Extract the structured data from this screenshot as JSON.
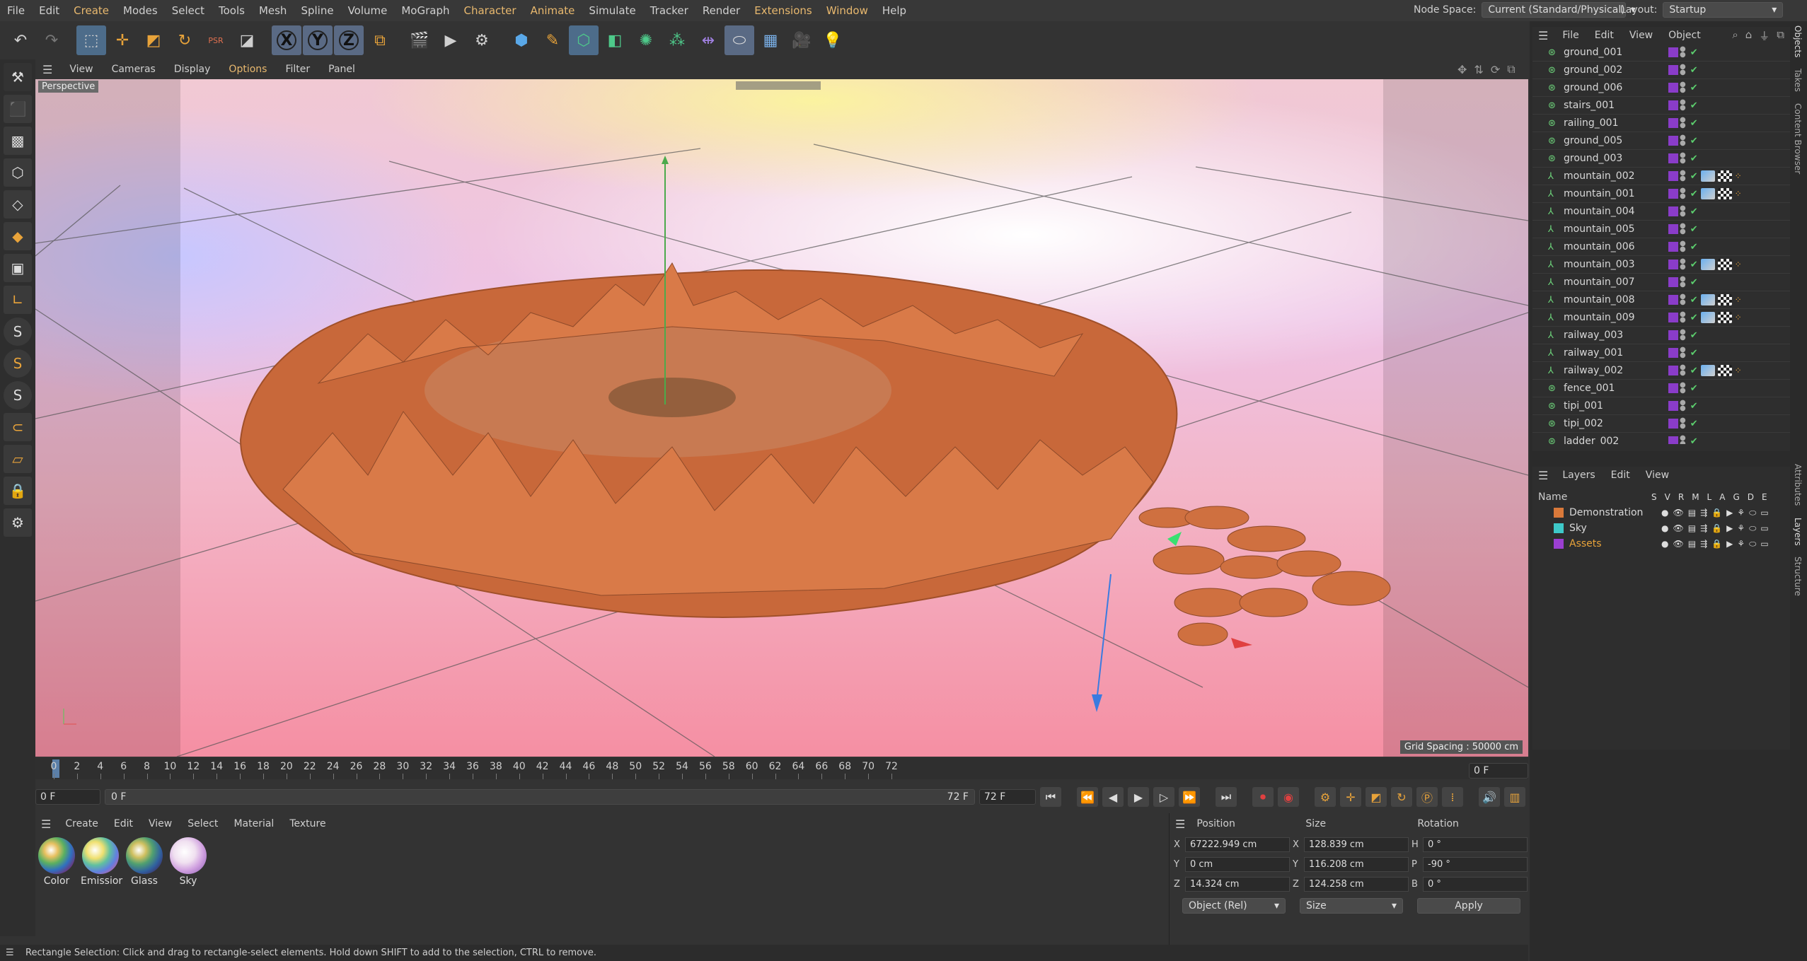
{
  "menubar": {
    "items": [
      "File",
      "Edit",
      "Create",
      "Modes",
      "Select",
      "Tools",
      "Mesh",
      "Spline",
      "Volume",
      "MoGraph",
      "Character",
      "Animate",
      "Simulate",
      "Tracker",
      "Render",
      "Extensions",
      "Window",
      "Help"
    ],
    "node_space_label": "Node Space:",
    "node_space_value": "Current (Standard/Physical)",
    "layout_label": "Layout:",
    "layout_value": "Startup"
  },
  "toolbar": {
    "axis_x": "X",
    "axis_y": "Y",
    "axis_z": "Z",
    "psr": "PSR"
  },
  "viewport": {
    "menu": [
      "View",
      "Cameras",
      "Display",
      "Options",
      "Filter",
      "Panel"
    ],
    "label": "Perspective",
    "grid_spacing": "Grid Spacing : 50000 cm"
  },
  "timeline": {
    "ticks": [
      "0",
      "2",
      "4",
      "6",
      "8",
      "10",
      "12",
      "14",
      "16",
      "18",
      "20",
      "22",
      "24",
      "26",
      "28",
      "30",
      "32",
      "34",
      "36",
      "38",
      "40",
      "42",
      "44",
      "46",
      "48",
      "50",
      "52",
      "54",
      "56",
      "58",
      "60",
      "62",
      "64",
      "66",
      "68",
      "70",
      "72"
    ],
    "current_frame": "0 F",
    "start_frame": "0 F",
    "range_start": "0 F",
    "range_end": "72 F",
    "end_frame": "72 F"
  },
  "materials": {
    "menu": [
      "Create",
      "Edit",
      "View",
      "Select",
      "Material",
      "Texture"
    ],
    "items": [
      {
        "name": "Color"
      },
      {
        "name": "Emissior"
      },
      {
        "name": "Glass"
      },
      {
        "name": "Sky"
      }
    ]
  },
  "coords": {
    "position_header": "Position",
    "size_header": "Size",
    "rotation_header": "Rotation",
    "px": "67222.949 cm",
    "py": "0 cm",
    "pz": "14.324 cm",
    "sx": "128.839 cm",
    "sy": "116.208 cm",
    "sz": "124.258 cm",
    "rh": "0 °",
    "rp": "-90 °",
    "rb": "0 °",
    "label_x": "X",
    "label_y": "Y",
    "label_z": "Z",
    "label_h": "H",
    "label_p": "P",
    "label_b": "B",
    "mode": "Object (Rel)",
    "size_mode": "Size",
    "apply": "Apply"
  },
  "objects": {
    "menu": [
      "File",
      "Edit",
      "View",
      "Object"
    ],
    "items": [
      {
        "name": "ground_001",
        "tags": false
      },
      {
        "name": "ground_002",
        "tags": false
      },
      {
        "name": "ground_006",
        "tags": false
      },
      {
        "name": "stairs_001",
        "tags": false
      },
      {
        "name": "railing_001",
        "tags": false
      },
      {
        "name": "ground_005",
        "tags": false
      },
      {
        "name": "ground_003",
        "tags": false
      },
      {
        "name": "mountain_002",
        "tags": true
      },
      {
        "name": "mountain_001",
        "tags": true
      },
      {
        "name": "mountain_004",
        "tags": false
      },
      {
        "name": "mountain_005",
        "tags": false
      },
      {
        "name": "mountain_006",
        "tags": false
      },
      {
        "name": "mountain_003",
        "tags": true
      },
      {
        "name": "mountain_007",
        "tags": false
      },
      {
        "name": "mountain_008",
        "tags": true
      },
      {
        "name": "mountain_009",
        "tags": true
      },
      {
        "name": "railway_003",
        "tags": false
      },
      {
        "name": "railway_001",
        "tags": false
      },
      {
        "name": "railway_002",
        "tags": true
      },
      {
        "name": "fence_001",
        "tags": false
      },
      {
        "name": "tipi_001",
        "tags": false
      },
      {
        "name": "tipi_002",
        "tags": false
      },
      {
        "name": "ladder_002",
        "tags": false
      }
    ]
  },
  "layers": {
    "menu": [
      "Layers",
      "Edit",
      "View"
    ],
    "name_header": "Name",
    "col_headers": [
      "S",
      "V",
      "R",
      "M",
      "L",
      "A",
      "G",
      "D",
      "E"
    ],
    "items": [
      {
        "name": "Demonstration",
        "color": "#d9793a"
      },
      {
        "name": "Sky",
        "color": "#3ec9c9"
      },
      {
        "name": "Assets",
        "color": "#9b3fd1"
      }
    ]
  },
  "side_tabs": [
    "Objects",
    "Takes",
    "Content Browser",
    "Attributes",
    "Layers",
    "Structure"
  ],
  "status": "Rectangle Selection: Click and drag to rectangle-select elements. Hold down SHIFT to add to the selection, CTRL to remove."
}
